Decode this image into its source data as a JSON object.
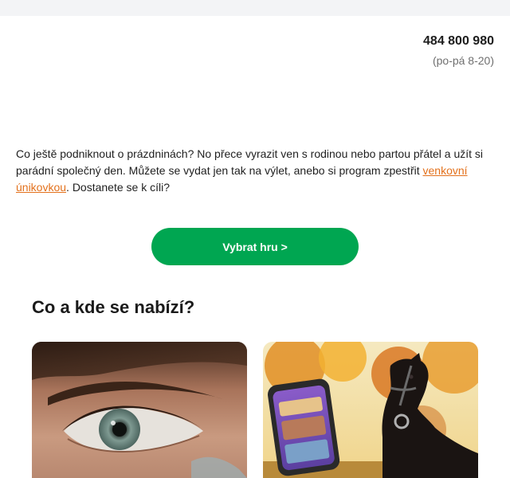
{
  "contact": {
    "phone": "484 800 980",
    "hours": "(po-pá 8-20)"
  },
  "intro": {
    "text_before": "Co ještě podniknout o prázdninách? No přece vyrazit ven s rodinou nebo partou přátel a užít si parádní společný den. Můžete se vydat jen tak na výlet, anebo si program zpestřit ",
    "link_label": "venkovní únikovkou",
    "text_after": ". Dostanete se k cíli?"
  },
  "cta": {
    "label": "Vybrat hru >"
  },
  "section": {
    "title": "Co a kde se nabízí?"
  },
  "colors": {
    "accent_green": "#00a651",
    "link_orange": "#e3711c",
    "top_band": "#f3f4f6"
  },
  "cards": [
    {
      "image": "eye-closeup-photo"
    },
    {
      "image": "phone-and-horse-photo"
    }
  ]
}
